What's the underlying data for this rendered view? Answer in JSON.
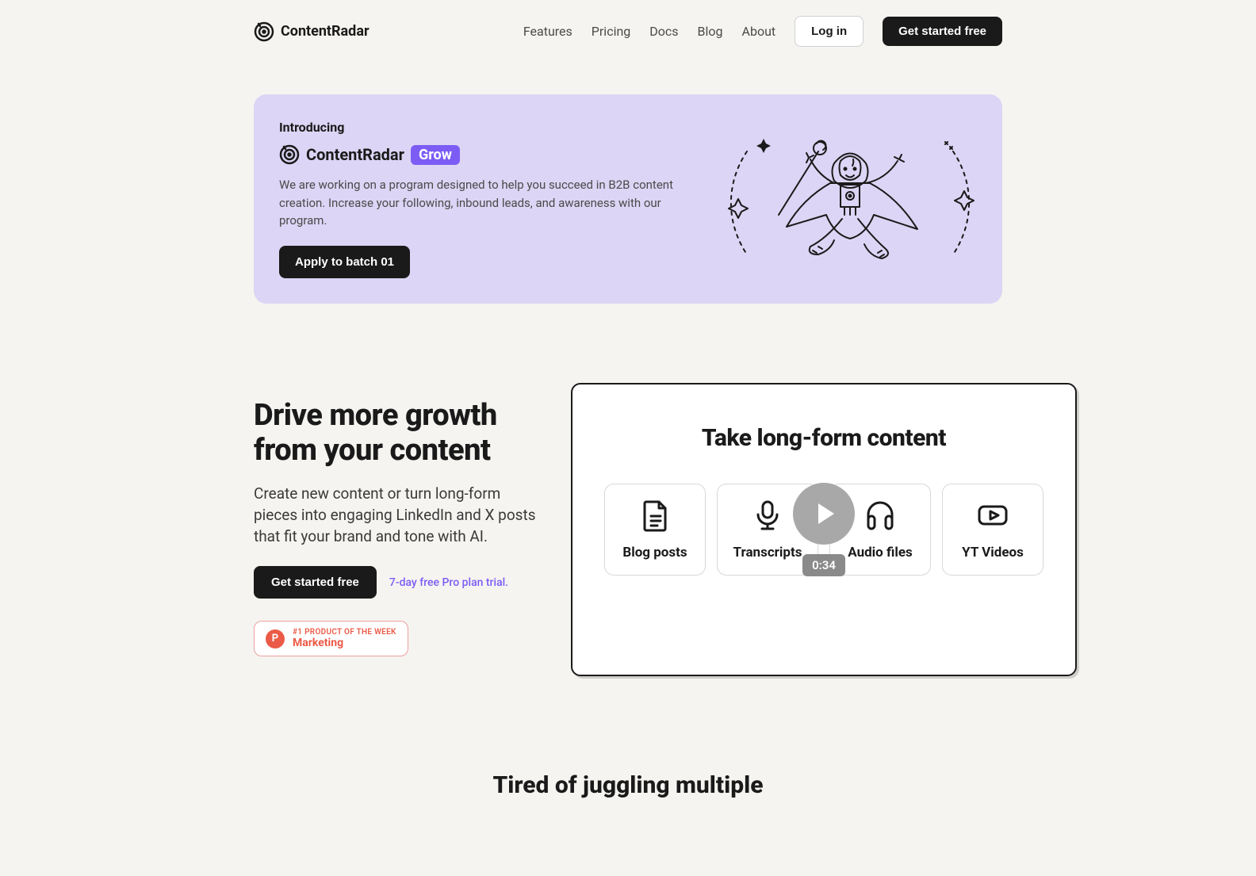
{
  "brand": "ContentRadar",
  "nav": {
    "items": [
      "Features",
      "Pricing",
      "Docs",
      "Blog",
      "About"
    ],
    "login": "Log in",
    "cta": "Get started free"
  },
  "banner": {
    "intro": "Introducing",
    "brand": "ContentRadar",
    "badge": "Grow",
    "desc": "We are working on a program designed to help you succeed in B2B content creation. Increase your following, inbound leads, and awareness with our program.",
    "apply": "Apply to batch 01"
  },
  "hero": {
    "title": "Drive more growth from your content",
    "desc": "Create new content or turn long-form pieces into engaging LinkedIn and X posts that fit your brand and tone with AI.",
    "cta": "Get started free",
    "trial": "7-day free Pro plan trial.",
    "ph_line1": "#1 PRODUCT OF THE WEEK",
    "ph_line2": "Marketing",
    "ph_letter": "P"
  },
  "video": {
    "title": "Take long-form content",
    "types": [
      "Blog posts",
      "Transcripts",
      "Audio files",
      "YT Videos"
    ],
    "duration": "0:34"
  },
  "teaser": {
    "title": "Tired of juggling multiple"
  }
}
